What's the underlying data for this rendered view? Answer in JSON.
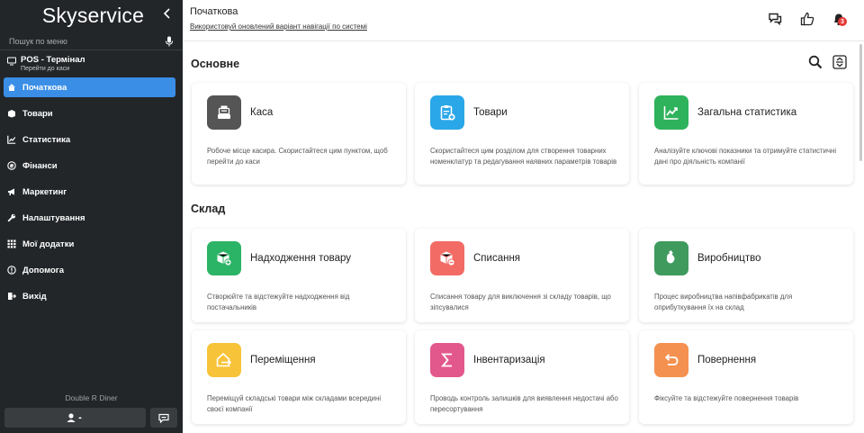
{
  "sidebar": {
    "logo": "Skyservice",
    "search_placeholder": "Пошук по меню",
    "pos": {
      "title": "POS - Термінал",
      "subtitle": "Перейти до каси"
    },
    "items": [
      {
        "label": "Початкова",
        "icon": "home-icon",
        "active": true
      },
      {
        "label": "Товари",
        "icon": "box-icon"
      },
      {
        "label": "Статистика",
        "icon": "chart-icon"
      },
      {
        "label": "Фінанси",
        "icon": "finance-icon"
      },
      {
        "label": "Маркетинг",
        "icon": "megaphone-icon"
      },
      {
        "label": "Налаштування",
        "icon": "wrench-icon"
      },
      {
        "label": "Мої додатки",
        "icon": "apps-icon"
      },
      {
        "label": "Допомога",
        "icon": "help-icon"
      },
      {
        "label": "Вихід",
        "icon": "exit-icon"
      }
    ],
    "company": "Double R Diner"
  },
  "header": {
    "title": "Початкова",
    "nav_link": "Використовуй оновлений варіант навігації по системі",
    "notifications_count": "3"
  },
  "sections": {
    "main": {
      "title": "Основне",
      "cards": [
        {
          "title": "Каса",
          "desc": "Робоче місце касира. Скористайтеся цим пунктом, щоб перейти до каси",
          "icon": "cash-register-icon",
          "color": "#555555"
        },
        {
          "title": "Товари",
          "desc": "Скористайтеся цим розділом для створення товарних номенклатур та редагування наявних параметрів товарів",
          "icon": "clipboard-add-icon",
          "color": "#2aa7e8"
        },
        {
          "title": "Загальна статистика",
          "desc": "Аналізуйте ключові показники та отримуйте статистичні дані про діяльність компанії",
          "icon": "stats-icon",
          "color": "#2fb25c"
        }
      ]
    },
    "warehouse": {
      "title": "Склад",
      "cards": [
        {
          "title": "Надходження товару",
          "desc": "Створюйте та відстежуйте надходження від постачальників",
          "icon": "box-in-icon",
          "color": "#2bb465"
        },
        {
          "title": "Списання",
          "desc": "Списання товару для виключення зі складу товарів, що зіпсувалися",
          "icon": "box-out-icon",
          "color": "#f26b65"
        },
        {
          "title": "Виробництво",
          "desc": "Процес виробництва напівфабрикатів для оприбуткування їх на склад",
          "icon": "production-icon",
          "color": "#3f9a5e"
        },
        {
          "title": "Переміщення",
          "desc": "Переміщуй складські товари між складами всередині своєї компанії",
          "icon": "transfer-icon",
          "color": "#f7c339"
        },
        {
          "title": "Інвентаризація",
          "desc": "Проводь контроль залишків для виявлення недостачі або пересортування",
          "icon": "sigma-icon",
          "color": "#e2588c"
        },
        {
          "title": "Повернення",
          "desc": "Фіксуйте та відстежуйте повернення товарів",
          "icon": "return-icon",
          "color": "#f59150"
        }
      ]
    }
  }
}
